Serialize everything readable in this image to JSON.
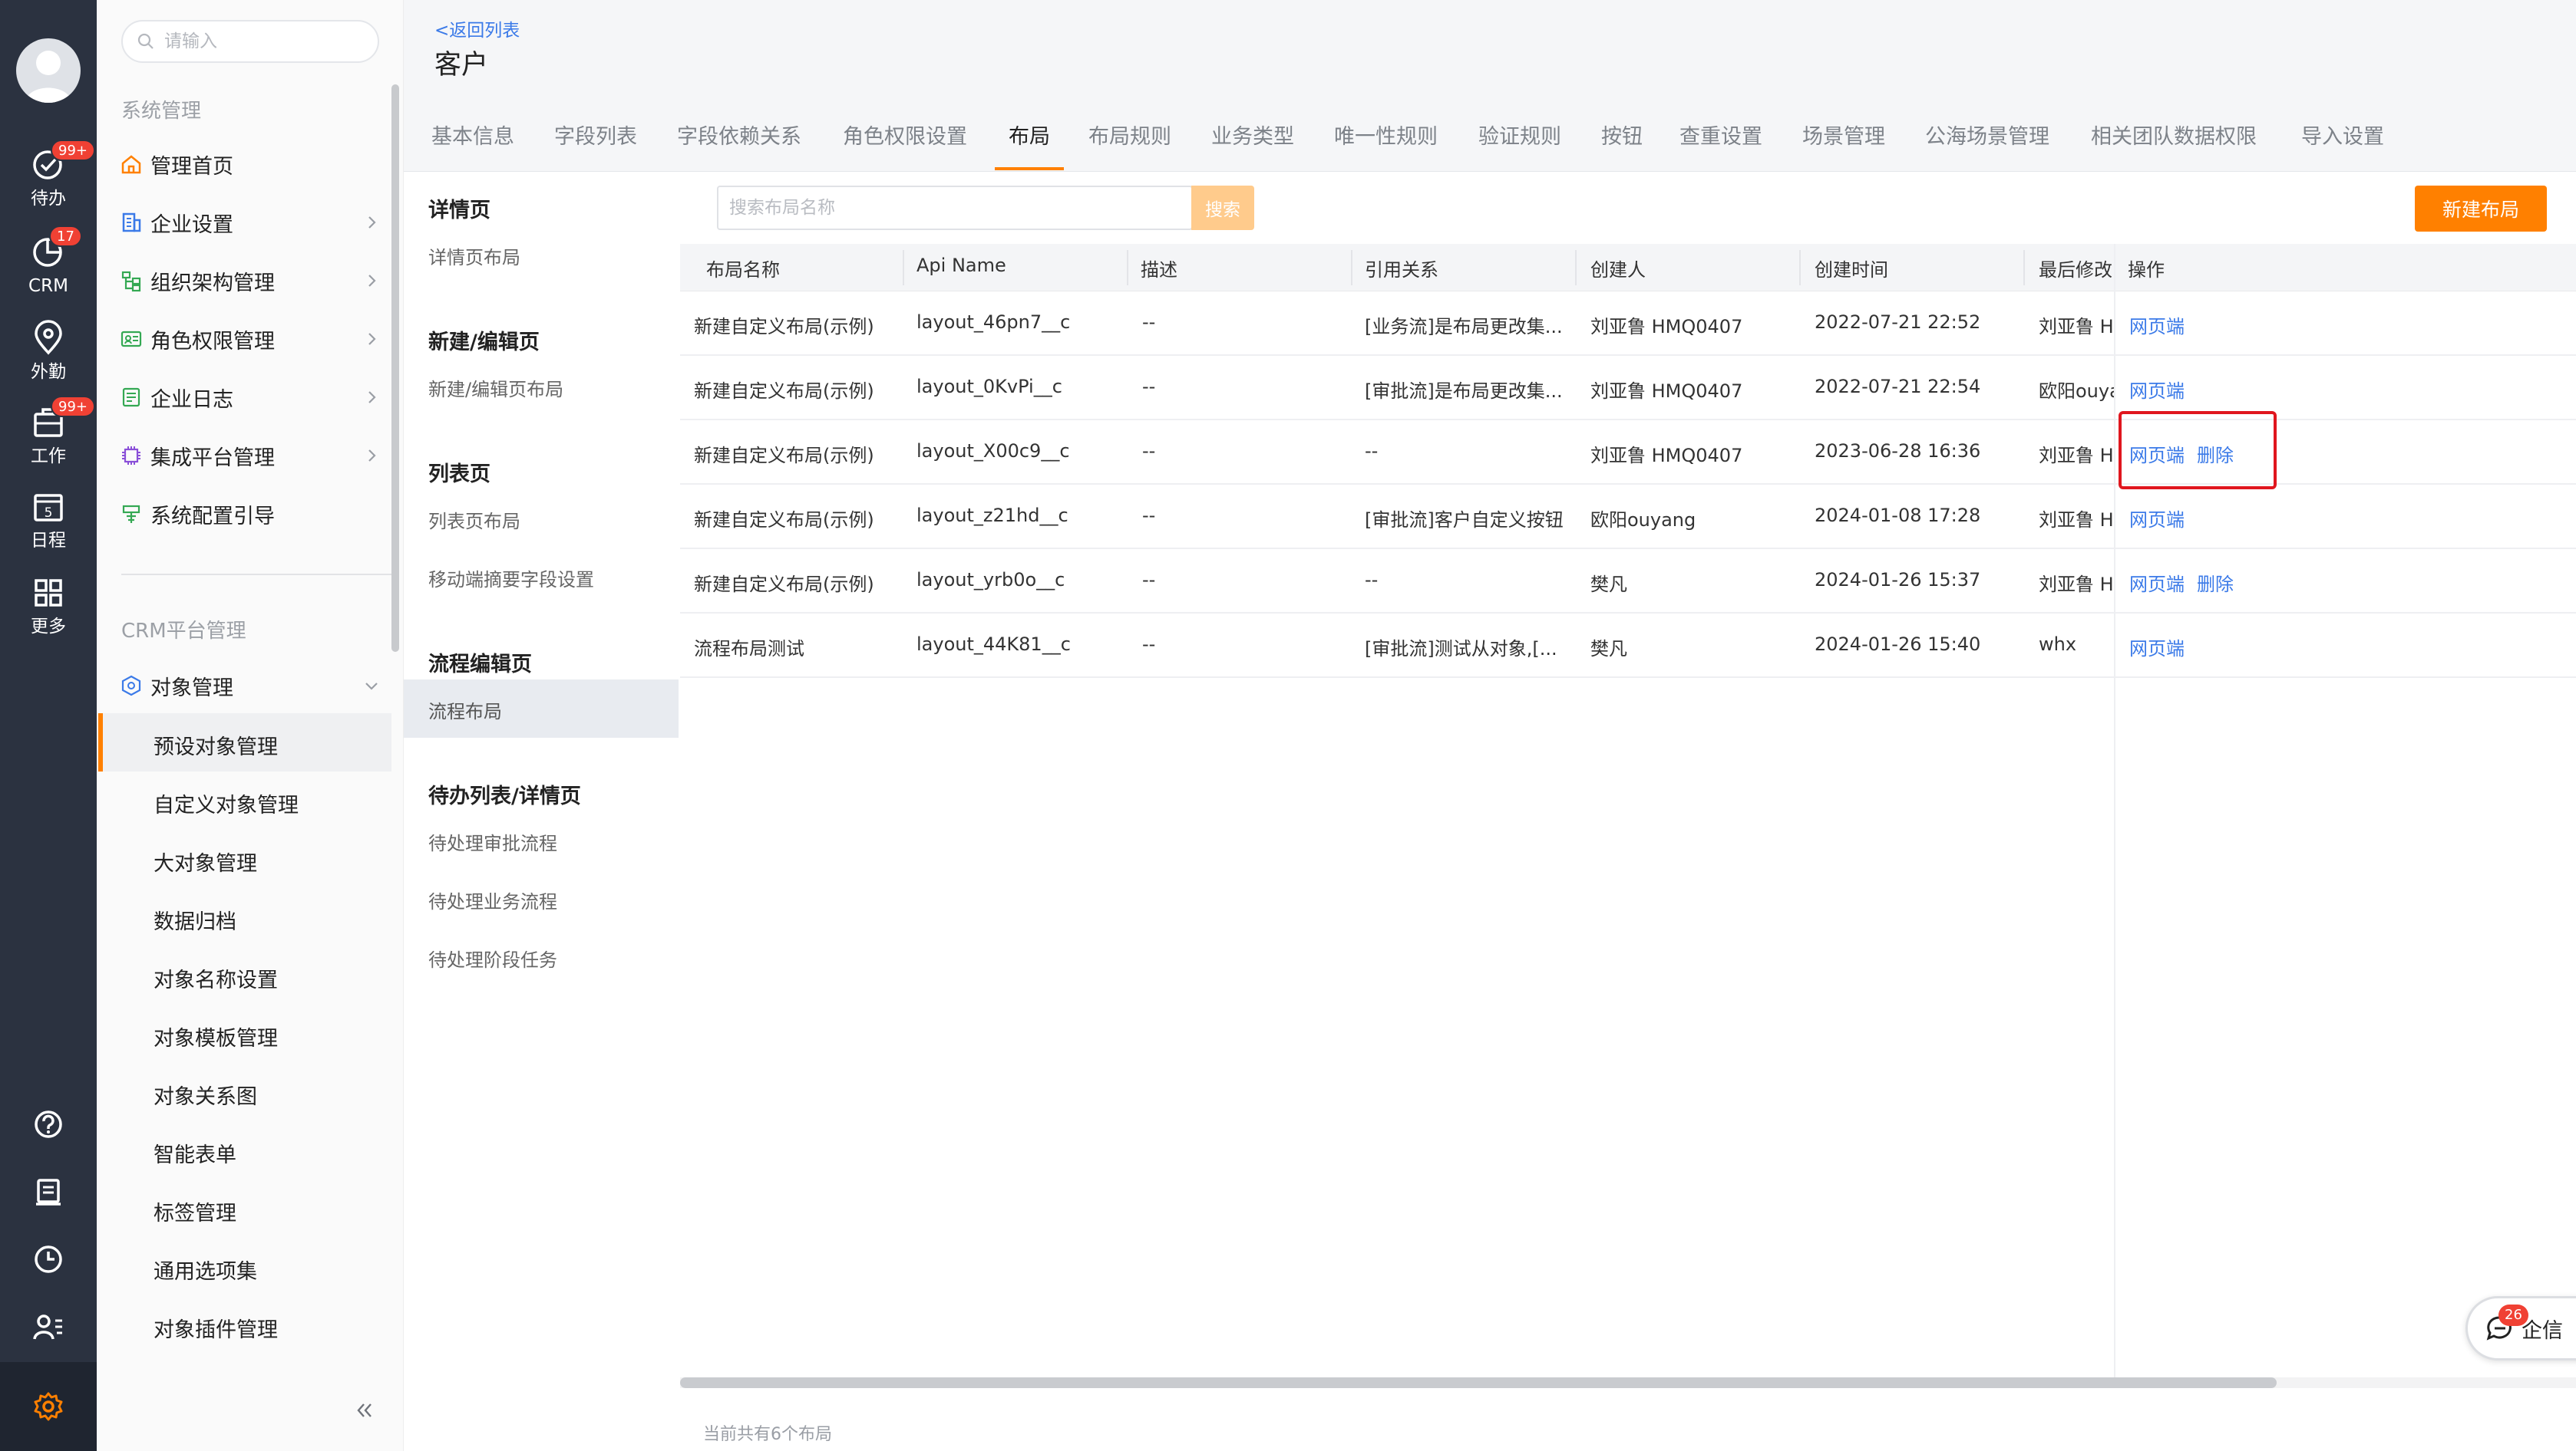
{
  "rail": {
    "items": [
      {
        "label": "待办",
        "badge": "99+"
      },
      {
        "label": "CRM",
        "badge": "17"
      },
      {
        "label": "外勤",
        "badge": ""
      },
      {
        "label": "工作",
        "badge": "99+"
      },
      {
        "label": "日程",
        "badge": ""
      },
      {
        "label": "更多",
        "badge": ""
      }
    ],
    "calendar_day": "5"
  },
  "menu": {
    "search_placeholder": "请输入",
    "section_system": "系统管理",
    "items": [
      "管理首页",
      "企业设置",
      "组织架构管理",
      "角色权限管理",
      "企业日志",
      "集成平台管理",
      "系统配置引导"
    ],
    "section_crm": "CRM平台管理",
    "object_mgmt": "对象管理",
    "sub_items": [
      "预设对象管理",
      "自定义对象管理",
      "大对象管理",
      "数据归档",
      "对象名称设置",
      "对象模板管理",
      "对象关系图",
      "智能表单",
      "标签管理",
      "通用选项集",
      "对象插件管理"
    ]
  },
  "header": {
    "back": "<返回列表",
    "title": "客户"
  },
  "tabs": [
    "基本信息",
    "字段列表",
    "字段依赖关系",
    "角色权限设置",
    "布局",
    "布局规则",
    "业务类型",
    "唯一性规则",
    "验证规则",
    "按钮",
    "查重设置",
    "场景管理",
    "公海场景管理",
    "相关团队数据权限",
    "导入设置"
  ],
  "subnav": [
    {
      "group": "详情页",
      "items": [
        "详情页布局"
      ]
    },
    {
      "group": "新建/编辑页",
      "items": [
        "新建/编辑页布局"
      ]
    },
    {
      "group": "列表页",
      "items": [
        "列表页布局",
        "移动端摘要字段设置"
      ]
    },
    {
      "group": "流程编辑页",
      "items": [
        "流程布局"
      ]
    },
    {
      "group": "待办列表/详情页",
      "items": [
        "待处理审批流程",
        "待处理业务流程",
        "待处理阶段任务"
      ]
    }
  ],
  "toolbar": {
    "search_placeholder": "搜索布局名称",
    "search_btn": "搜索",
    "new_btn": "新建布局"
  },
  "table": {
    "columns": [
      "布局名称",
      "Api Name",
      "描述",
      "引用关系",
      "创建人",
      "创建时间",
      "最后修改",
      "操作"
    ],
    "rows": [
      {
        "name": "新建自定义布局(示例)",
        "api": "layout_46pn7__c",
        "desc": "--",
        "ref": "[业务流]是布局更改集...",
        "creator": "刘亚鲁 HMQ0407",
        "created": "2022-07-21 22:52",
        "modifier": "刘亚鲁 HI",
        "ops": [
          "网页端"
        ]
      },
      {
        "name": "新建自定义布局(示例)",
        "api": "layout_0KvPi__c",
        "desc": "--",
        "ref": "[审批流]是布局更改集...",
        "creator": "刘亚鲁 HMQ0407",
        "created": "2022-07-21 22:54",
        "modifier": "欧阳ouya",
        "ops": [
          "网页端"
        ]
      },
      {
        "name": "新建自定义布局(示例)",
        "api": "layout_X00c9__c",
        "desc": "--",
        "ref": "--",
        "creator": "刘亚鲁 HMQ0407",
        "created": "2023-06-28 16:36",
        "modifier": "刘亚鲁 HI",
        "ops": [
          "网页端",
          "删除"
        ]
      },
      {
        "name": "新建自定义布局(示例)",
        "api": "layout_z21hd__c",
        "desc": "--",
        "ref": "[审批流]客户自定义按钮",
        "creator": "欧阳ouyang",
        "created": "2024-01-08 17:28",
        "modifier": "刘亚鲁 HI",
        "ops": [
          "网页端"
        ]
      },
      {
        "name": "新建自定义布局(示例)",
        "api": "layout_yrb0o__c",
        "desc": "--",
        "ref": "--",
        "creator": "樊凡",
        "created": "2024-01-26 15:37",
        "modifier": "刘亚鲁 HI",
        "ops": [
          "网页端",
          "删除"
        ]
      },
      {
        "name": "流程布局测试",
        "api": "layout_44K81__c",
        "desc": "--",
        "ref": "[审批流]测试从对象,[...",
        "creator": "樊凡",
        "created": "2024-01-26 15:40",
        "modifier": "whx",
        "ops": [
          "网页端"
        ]
      }
    ]
  },
  "footer": {
    "count": "当前共有6个布局"
  },
  "chat": {
    "label": "企信",
    "badge": "26"
  },
  "colors": {
    "accent": "#ff8000",
    "link": "#3b7ae8",
    "rail": "#2b3240",
    "highlight": "#e0161e"
  }
}
